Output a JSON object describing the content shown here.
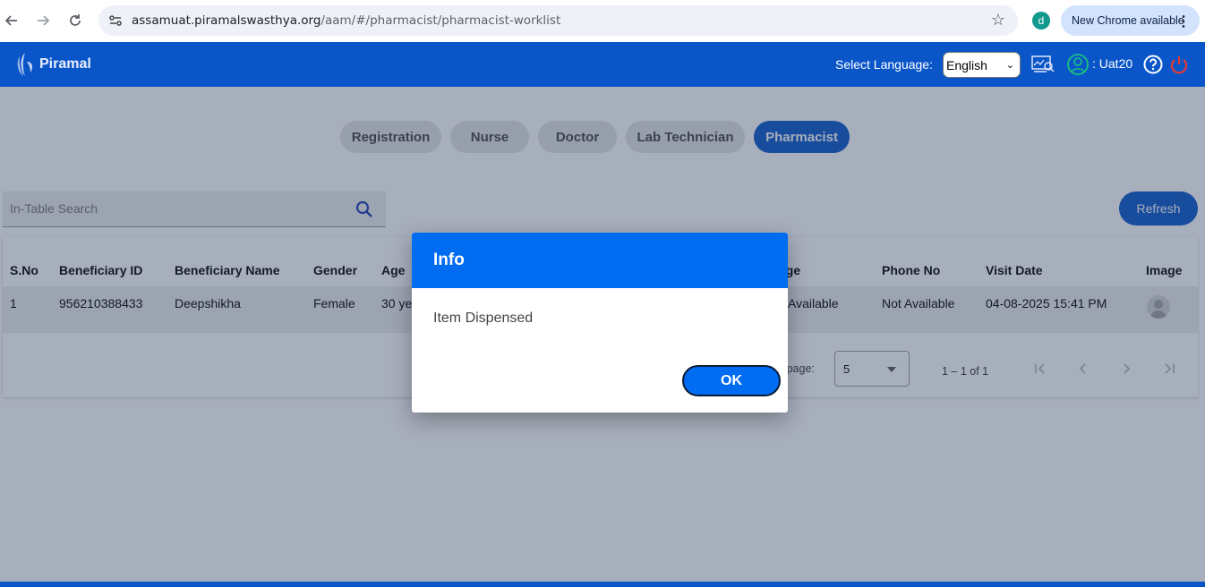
{
  "browser": {
    "url_host": "assamuat.piramalswasthya.org",
    "url_path": "/aam/#/pharmacist/pharmacist-worklist",
    "profile_initial": "d",
    "update_label": "New Chrome available"
  },
  "header": {
    "brand": "Piramal",
    "language_label": "Select Language:",
    "language_value": "English",
    "user_label": ": Uat20"
  },
  "tabs": [
    {
      "label": "Registration"
    },
    {
      "label": "Nurse"
    },
    {
      "label": "Doctor"
    },
    {
      "label": "Lab Technician"
    },
    {
      "label": "Pharmacist"
    }
  ],
  "search": {
    "placeholder": "In-Table Search"
  },
  "refresh_label": "Refresh",
  "table": {
    "headers": [
      "S.No",
      "Beneficiary ID",
      "Beneficiary Name",
      "Gender",
      "Age",
      "age",
      "Phone No",
      "Visit Date",
      "Image"
    ],
    "row": {
      "sno": "1",
      "beneficiary_id": "956210388433",
      "name": "Deepshikha",
      "gender": "Female",
      "age": "30 ye",
      "district": "t Available",
      "phone": "Not Available",
      "visit_date": "04-08-2025 15:41 PM"
    }
  },
  "pager": {
    "label": "er page:",
    "page_size": "5",
    "range": "1 – 1 of 1"
  },
  "dialog": {
    "title": "Info",
    "message": "Item Dispensed",
    "ok_label": "OK"
  },
  "colors": {
    "brand_blue": "#0a56c9",
    "dialog_blue": "#006cf2"
  }
}
